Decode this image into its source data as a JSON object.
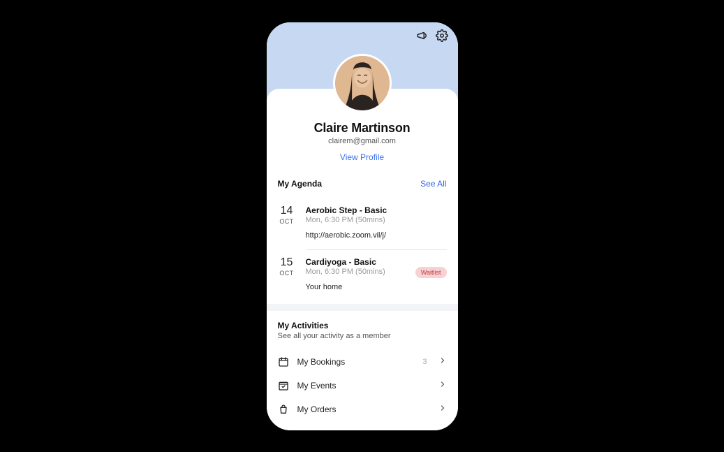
{
  "profile": {
    "name": "Claire Martinson",
    "email": "clairem@gmail.com",
    "view_profile": "View Profile"
  },
  "agenda": {
    "heading": "My Agenda",
    "see_all": "See All",
    "items": [
      {
        "day": "14",
        "month": "OCT",
        "title": "Aerobic Step - Basic",
        "subtitle": "Mon, 6:30 PM (50mins)",
        "location": "http://aerobic.zoom.vil/j/",
        "badge": ""
      },
      {
        "day": "15",
        "month": "OCT",
        "title": "Cardiyoga - Basic",
        "subtitle": "Mon, 6:30 PM (50mins)",
        "location": "Your home",
        "badge": "Waitlist"
      }
    ]
  },
  "activities": {
    "heading": "My Activities",
    "subtitle": "See all your activity as a member",
    "rows": [
      {
        "label": "My Bookings",
        "count": "3"
      },
      {
        "label": "My Events",
        "count": ""
      },
      {
        "label": "My Orders",
        "count": ""
      }
    ]
  }
}
